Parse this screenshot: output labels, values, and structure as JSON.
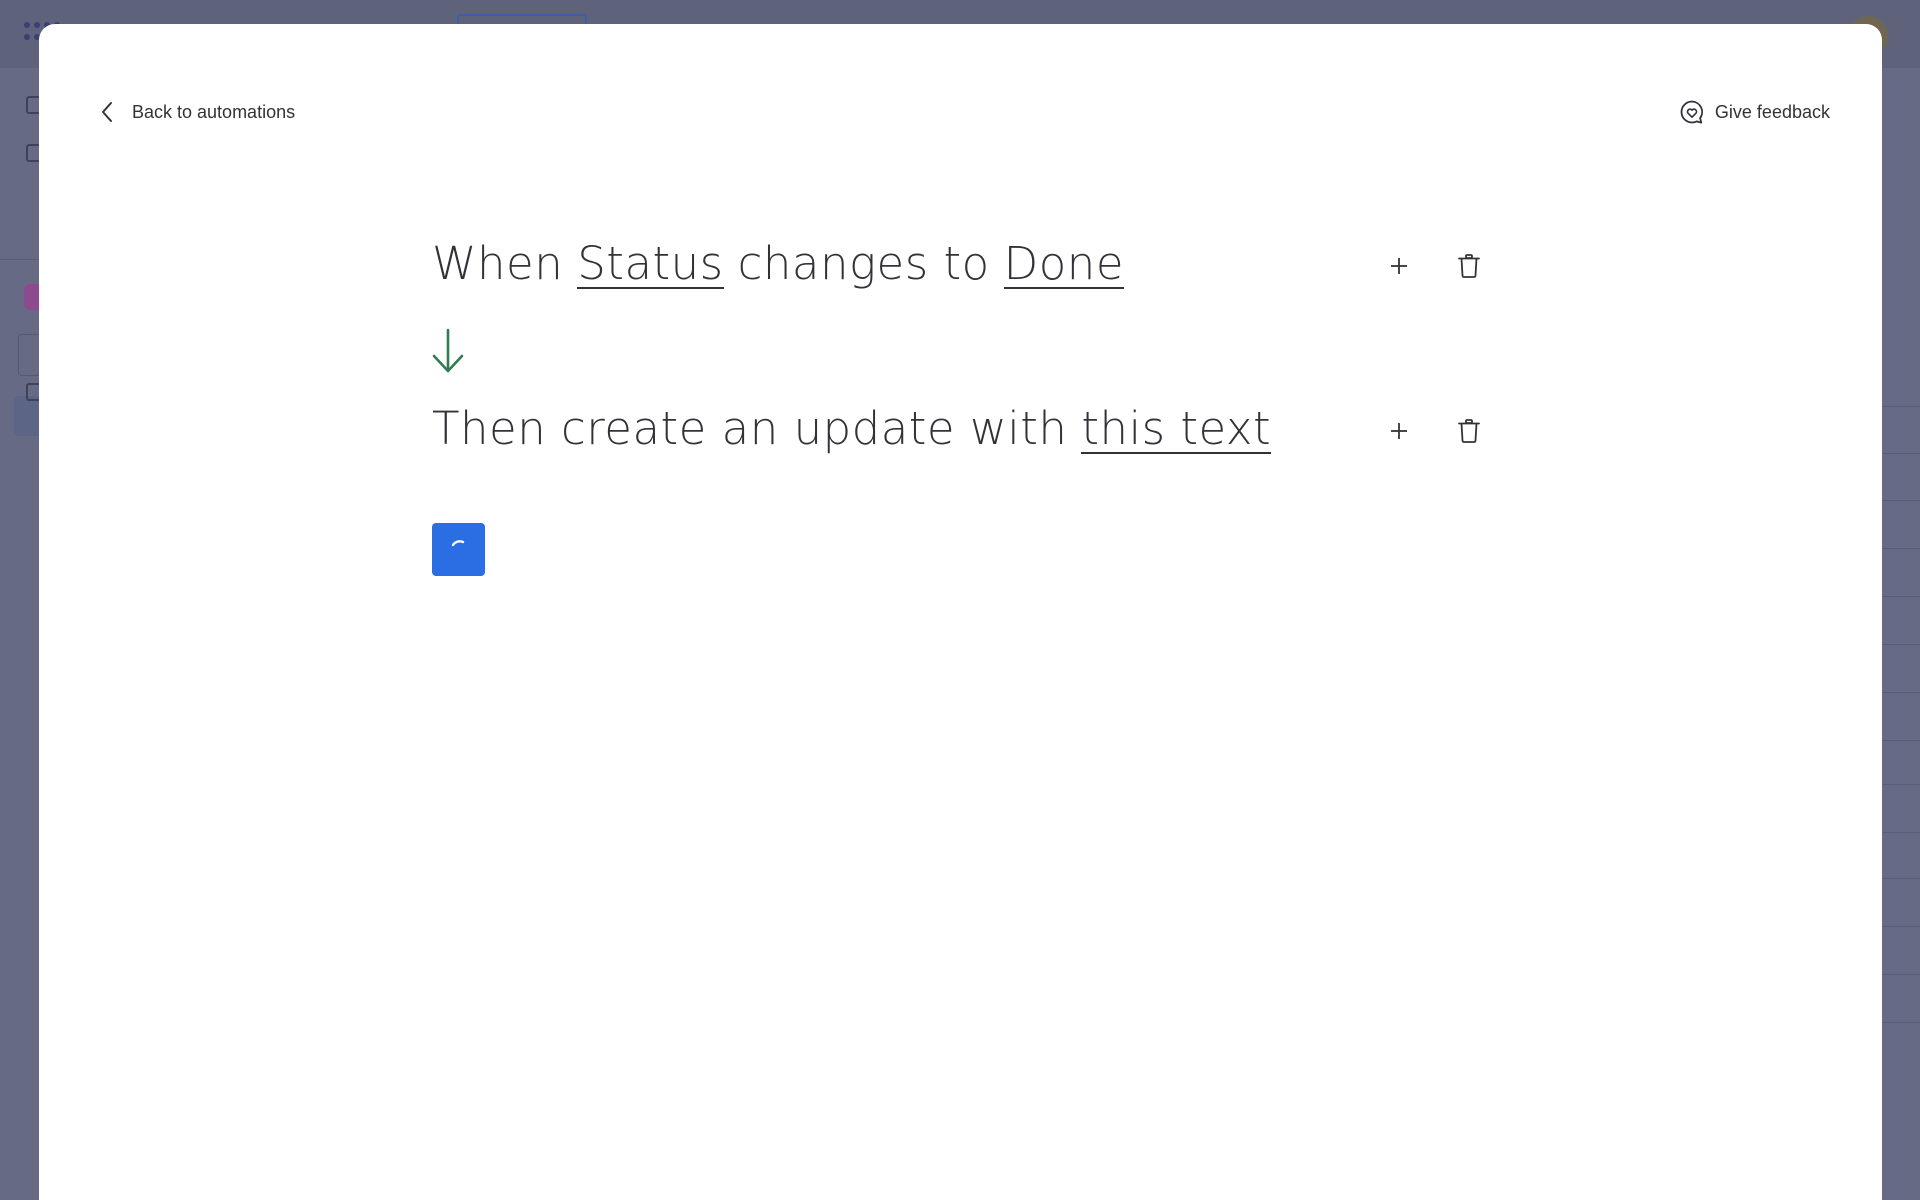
{
  "header": {
    "back_label": "Back to automations",
    "feedback_label": "Give feedback"
  },
  "trigger": {
    "parts": [
      {
        "text": "When",
        "editable": false
      },
      {
        "text": "Status",
        "editable": true
      },
      {
        "text": "changes to",
        "editable": false
      },
      {
        "text": "Done",
        "editable": true
      }
    ]
  },
  "action": {
    "parts": [
      {
        "text": "Then create an update with",
        "editable": false
      },
      {
        "text": "this text",
        "editable": true
      }
    ]
  },
  "colors": {
    "accent": "#2b6ee3",
    "flow_arrow": "#2f7d4f",
    "text": "#323338",
    "overlay": "#676a85"
  },
  "icons": {
    "back": "chevron-left-icon",
    "feedback": "feedback-heart-bubble-icon",
    "add": "plus-icon",
    "delete": "trash-icon",
    "flow": "arrow-down-icon",
    "loading": "spinner-icon"
  },
  "state": {
    "submit_button": "loading"
  }
}
